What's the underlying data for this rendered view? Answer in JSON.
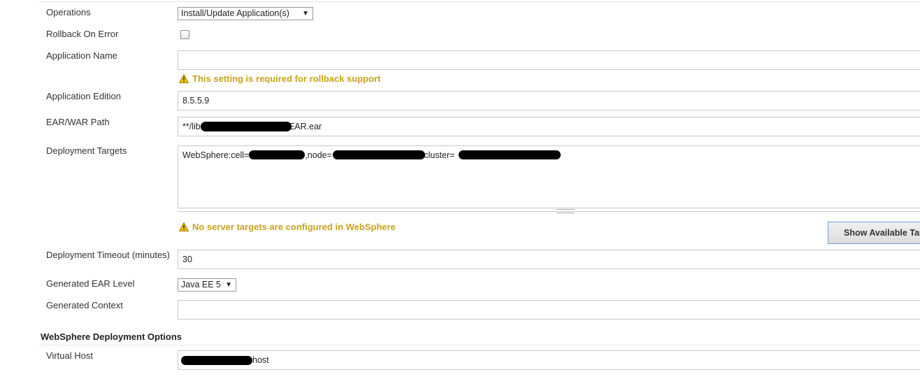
{
  "form": {
    "operations": {
      "label": "Operations",
      "value": "Install/Update Application(s)"
    },
    "rollback": {
      "label": "Rollback On Error"
    },
    "app_name": {
      "label": "Application Name",
      "value": "",
      "warning": "This setting is required for rollback support"
    },
    "app_edition": {
      "label": "Application Edition",
      "value": "8.5.5.9"
    },
    "ear_path": {
      "label": "EAR/WAR Path",
      "value_prefix": "**/libs",
      "value_suffix": "EAR.ear"
    },
    "deploy_targets": {
      "label": "Deployment Targets",
      "part1": "WebSphere:cell=",
      "part2": ",node=",
      "part3": ",cluster=",
      "warning": "No server targets are configured in WebSphere",
      "button": "Show Available Targets"
    },
    "timeout": {
      "label": "Deployment Timeout (minutes)",
      "value": "30"
    },
    "ear_level": {
      "label": "Generated EAR Level",
      "value": "Java EE 5"
    },
    "context": {
      "label": "Generated Context",
      "value": ""
    },
    "section_title": "WebSphere Deployment Options",
    "virtual_host": {
      "label": "Virtual Host",
      "value_suffix": "host"
    }
  },
  "icons": {
    "warning": "warning-triangle-icon",
    "dropdown": "dropdown-arrow-icon"
  },
  "colors": {
    "warning_text": "#c8a31a",
    "button_border": "#6d9cd6"
  }
}
